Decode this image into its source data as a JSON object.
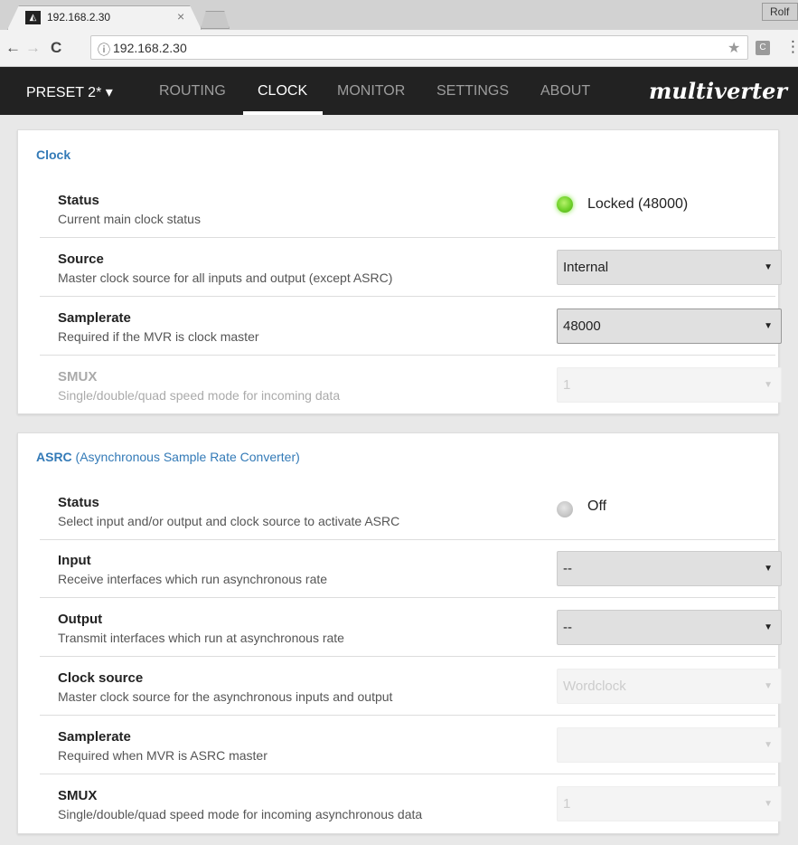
{
  "browser": {
    "tab_title": "192.168.2.30",
    "tab_close": "×",
    "profile": "Rolf",
    "url": "192.168.2.30",
    "info_icon": "ⓘ",
    "back": "←",
    "forward": "→",
    "reload": "C",
    "star": "★",
    "extension": "C",
    "menu": "⋮"
  },
  "navbar": {
    "preset": "PRESET 2* ▾",
    "items": [
      "ROUTING",
      "CLOCK",
      "MONITOR",
      "SETTINGS",
      "ABOUT"
    ],
    "active": "CLOCK",
    "brand": "multiverter"
  },
  "clock_panel": {
    "title": "Clock",
    "rows": [
      {
        "label": "Status",
        "desc": "Current main clock status",
        "status": "Locked (48000)",
        "led": "green"
      },
      {
        "label": "Source",
        "desc": "Master clock source for all inputs and output (except ASRC)",
        "value": "Internal"
      },
      {
        "label": "Samplerate",
        "desc": "Required if the MVR is clock master",
        "value": "48000"
      },
      {
        "label": "SMUX",
        "desc": "Single/double/quad speed mode for incoming data",
        "value": "1",
        "disabled": true
      }
    ]
  },
  "asrc_panel": {
    "title_bold": "ASRC",
    "title_rest": " (Asynchronous Sample Rate Converter)",
    "rows": [
      {
        "label": "Status",
        "desc": "Select input and/or output and clock source to activate ASRC",
        "status": "Off",
        "led": "gray"
      },
      {
        "label": "Input",
        "desc": "Receive interfaces which run asynchronous rate",
        "value": "--"
      },
      {
        "label": "Output",
        "desc": "Transmit interfaces which run at asynchronous rate",
        "value": "--"
      },
      {
        "label": "Clock source",
        "desc": "Master clock source for the asynchronous inputs and output",
        "value": "Wordclock",
        "disabled": true
      },
      {
        "label": "Samplerate",
        "desc": "Required when MVR is ASRC master",
        "value": "",
        "disabled": true
      },
      {
        "label": "SMUX",
        "desc": "Single/double/quad speed mode for incoming asynchronous data",
        "value": "1",
        "disabled": true
      }
    ]
  },
  "caret": "▼",
  "colors": {
    "navbar_bg": "#222222",
    "panel_title": "#337ab7",
    "led_on": "#6fd12a",
    "led_off": "#c6c6c6"
  }
}
